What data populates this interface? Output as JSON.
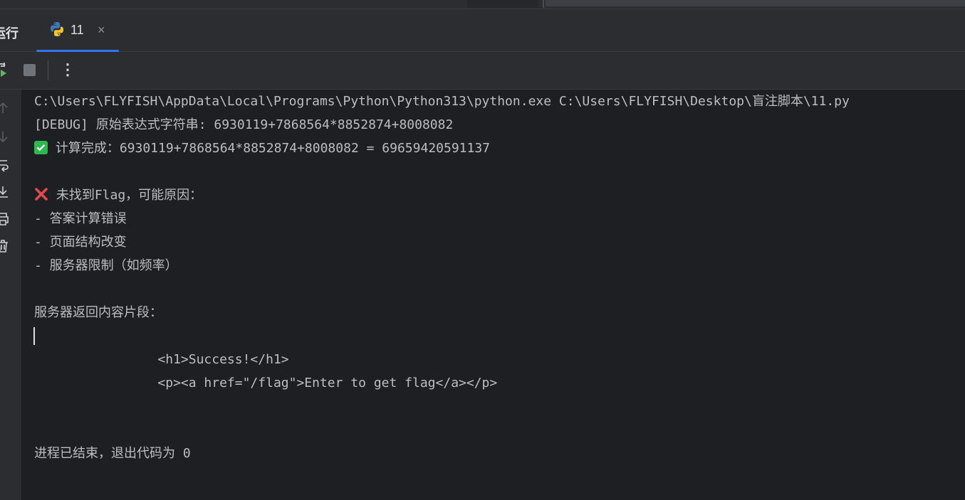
{
  "panel": {
    "title": "运行"
  },
  "tab": {
    "label": "11",
    "close": "×"
  },
  "toolbar": {
    "rerun_icon": "rerun-icon",
    "stop_icon": "stop-icon",
    "more": "⋮"
  },
  "console": {
    "cmd": "C:\\Users\\FLYFISH\\AppData\\Local\\Programs\\Python\\Python313\\python.exe C:\\Users\\FLYFISH\\Desktop\\盲注脚本\\11.py",
    "debug": "[DEBUG] 原始表达式字符串: 6930119+7868564*8852874+8008082",
    "calc": " 计算完成：6930119+7868564*8852874+8008082 = 69659420591137",
    "notfound": " 未找到Flag，可能原因：",
    "reason1": "- 答案计算错误",
    "reason2": "- 页面结构改变",
    "reason3": "- 服务器限制（如频率）",
    "snippet_title": "服务器返回内容片段：",
    "html1": "                <h1>Success!</h1>",
    "html2": "                <p><a href=\"/flag\">Enter to get flag</a></p>",
    "exit": "进程已结束，退出代码为 0"
  },
  "colors": {
    "accent": "#3574f0",
    "check": "#2fb84f",
    "cross": "#e5484d"
  }
}
